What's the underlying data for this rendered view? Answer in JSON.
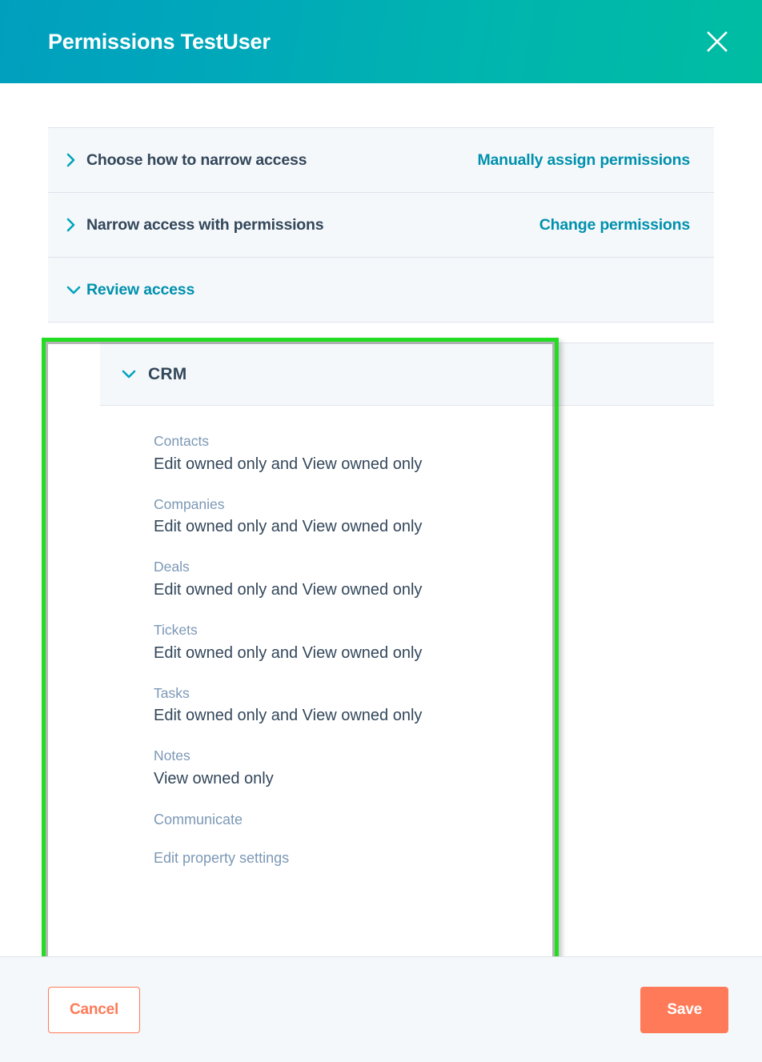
{
  "header": {
    "title": "Permissions TestUser",
    "close_icon": "close-icon",
    "gradient_from": "#009fbe",
    "gradient_to": "#00bda2"
  },
  "accordion": {
    "rows": [
      {
        "label": "Choose how to narrow access",
        "link": "Manually assign permissions",
        "chevron": "chevron-right-icon",
        "expanded": false
      },
      {
        "label": "Narrow access with permissions",
        "link": "Change permissions",
        "chevron": "chevron-right-icon",
        "expanded": false
      },
      {
        "label": "Review access",
        "link": "",
        "chevron": "chevron-down-icon",
        "expanded": true
      }
    ]
  },
  "review_panel": {
    "group": {
      "label": "CRM",
      "chevron": "chevron-down-icon",
      "expanded": true
    },
    "permissions": [
      {
        "name": "Contacts",
        "value": "Edit owned only and View owned only"
      },
      {
        "name": "Companies",
        "value": "Edit owned only and View owned only"
      },
      {
        "name": "Deals",
        "value": "Edit owned only and View owned only"
      },
      {
        "name": "Tickets",
        "value": "Edit owned only and View owned only"
      },
      {
        "name": "Tasks",
        "value": "Edit owned only and View owned only"
      },
      {
        "name": "Notes",
        "value": "View owned only"
      },
      {
        "name": "Communicate",
        "value": ""
      },
      {
        "name": "Edit property settings",
        "value": ""
      }
    ]
  },
  "highlight": {
    "color": "#22dd22",
    "target": "review-access-section"
  },
  "footer": {
    "cancel_label": "Cancel",
    "save_label": "Save",
    "accent_color": "#ff7a59"
  },
  "colors": {
    "link": "#0091ae",
    "heading": "#33475b",
    "muted": "#7c98b6",
    "panel_bg": "#f5f8fa",
    "border": "#dfe3eb"
  }
}
